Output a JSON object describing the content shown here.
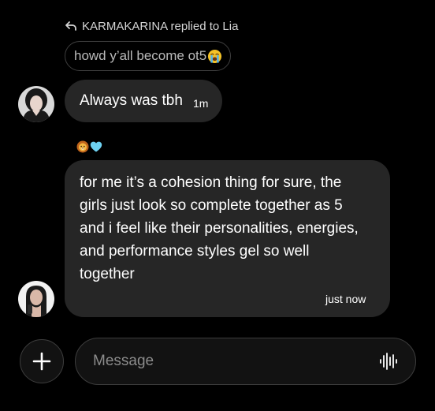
{
  "reply_context": {
    "label": "KARMAKARINA replied to Lia",
    "reply_icon": "reply-arrow-icon",
    "quoted_text": "howd y’all become ot5",
    "quoted_emoji": "loudly-crying-face-emoji"
  },
  "messages": [
    {
      "text": "Always was tbh",
      "time": "1m",
      "avatar": "avatar-woman-dark-hair"
    },
    {
      "reactions": [
        "lion-face-emoji",
        "light-blue-heart-emoji"
      ],
      "text": "for me it’s a cohesion thing for sure, the girls just look so complete together as 5 and i feel like their personalities, energies, and performance styles gel so well together",
      "time": "just now",
      "avatar": "avatar-woman-long-hair"
    }
  ],
  "composer": {
    "placeholder": "Message",
    "add_icon": "plus-icon",
    "voice_icon": "voice-waveform-icon"
  },
  "colors": {
    "background": "#000000",
    "bubble": "#262626",
    "border": "#3d3d3d",
    "placeholder": "#8c8c8c"
  }
}
